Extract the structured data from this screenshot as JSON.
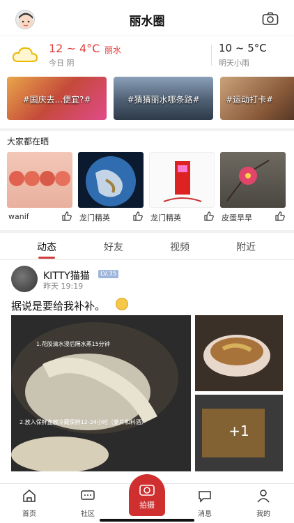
{
  "header": {
    "title": "丽水圈"
  },
  "weather": {
    "today_temp": "12 ~ 4°C",
    "city": "丽水",
    "today_label": "今日 阴",
    "tomorrow_temp": "10 ~ 5°C",
    "tomorrow_label": "明天小雨"
  },
  "topics": [
    {
      "label": "#国庆去...便宜?#",
      "color": "#c54a3a"
    },
    {
      "label": "#猜猜丽水哪条路#",
      "color": "#4f5f73"
    },
    {
      "label": "#运动打卡#",
      "color": "#8a5a3a"
    }
  ],
  "sharing": {
    "title": "大家都在晒",
    "cards": [
      {
        "user": "wanif"
      },
      {
        "user": "龙门精英"
      },
      {
        "user": "龙门精英"
      },
      {
        "user": "皮蛋旱旱"
      }
    ]
  },
  "feed_tabs": [
    "动态",
    "好友",
    "视频",
    "附近"
  ],
  "post": {
    "author": "KITTY猫猫",
    "level": "LV.35",
    "time": "昨天 19:19",
    "text": "据说是要给我补补。",
    "more_photos": "+1",
    "caption1": "1.花胶清水浸后隔水蒸15分钟",
    "caption2": "2.放入保鲜盒放冷藏保鲜12-24小时（姜片和料酒）"
  },
  "bottom_nav": [
    {
      "label": "首页"
    },
    {
      "label": "社区"
    },
    {
      "label": "拍摄"
    },
    {
      "label": "消息"
    },
    {
      "label": "我的"
    }
  ]
}
